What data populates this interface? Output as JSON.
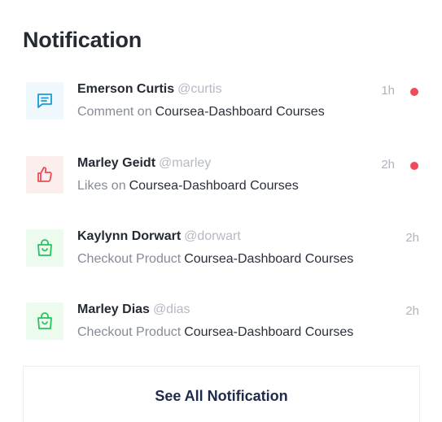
{
  "header": {
    "title": "Notification"
  },
  "notifications": [
    {
      "name": "Emerson Curtis",
      "handle": "@curtis",
      "action": "Comment on",
      "target": "Coursea-Dashboard Courses",
      "time": "1h",
      "unread": true,
      "icon": "comment-icon",
      "icon_color": "#1a9ad8"
    },
    {
      "name": "Marley Geidt",
      "handle": "@marley",
      "action": "Likes on",
      "target": "Coursea-Dashboard Courses",
      "time": "2h",
      "unread": true,
      "icon": "thumbs-up-icon",
      "icon_color": "#ef4b58"
    },
    {
      "name": "Kaylynn Dorwart",
      "handle": "@dorwart",
      "action": "Checkout Product",
      "target": "Coursea-Dashboard Courses",
      "time": "2h",
      "unread": false,
      "icon": "shopping-bag-icon",
      "icon_color": "#22c55e"
    },
    {
      "name": "Marley Dias",
      "handle": "@dias",
      "action": "Checkout Product",
      "target": "Coursea-Dashboard Courses",
      "time": "2h",
      "unread": false,
      "icon": "shopping-bag-icon",
      "icon_color": "#22c55e"
    }
  ],
  "footer": {
    "see_all_label": "See All Notification"
  },
  "colors": {
    "unread_dot": "#ef4b58",
    "title": "#252a33"
  }
}
